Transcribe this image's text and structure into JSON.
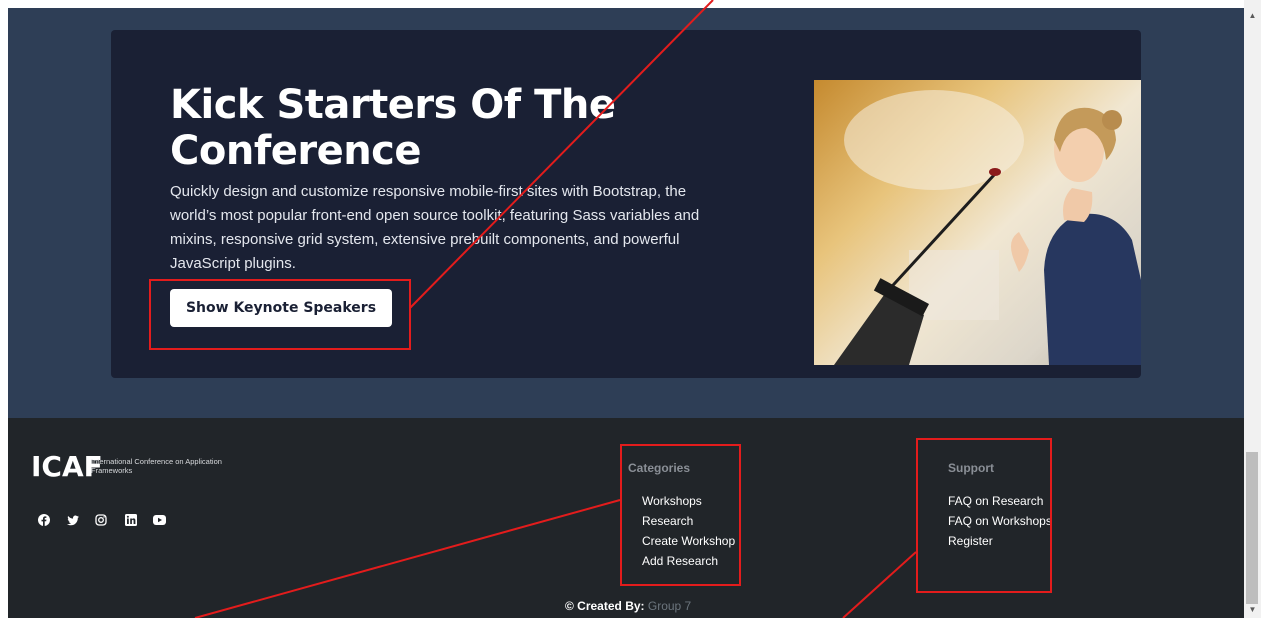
{
  "hero": {
    "title": "Kick Starters Of The Conference",
    "description": "Quickly design and customize responsive mobile-first sites with Bootstrap, the world’s most popular front-end open source toolkit, featuring Sass variables and mixins, responsive grid system, extensive prebuilt components, and powerful JavaScript plugins.",
    "button_label": "Show Keynote Speakers"
  },
  "footer": {
    "logo": "ICAF",
    "logo_subtitle": "International Conference on Application Frameworks",
    "social_icons": [
      "facebook-icon",
      "twitter-icon",
      "instagram-icon",
      "linkedin-icon",
      "youtube-icon"
    ],
    "categories": {
      "title": "Categories",
      "links": [
        "Workshops",
        "Research",
        "Create Workshop",
        "Add Research"
      ]
    },
    "support": {
      "title": "Support",
      "links": [
        "FAQ on Research",
        "FAQ on Workshops",
        "Register"
      ]
    },
    "copyright_prefix": "© Created By:",
    "copyright_group": "Group 7"
  },
  "colors": {
    "hero_background": "#2e3e56",
    "card_background": "#1a2034",
    "footer_background": "#212529",
    "annotation_red": "#e31c1c"
  }
}
